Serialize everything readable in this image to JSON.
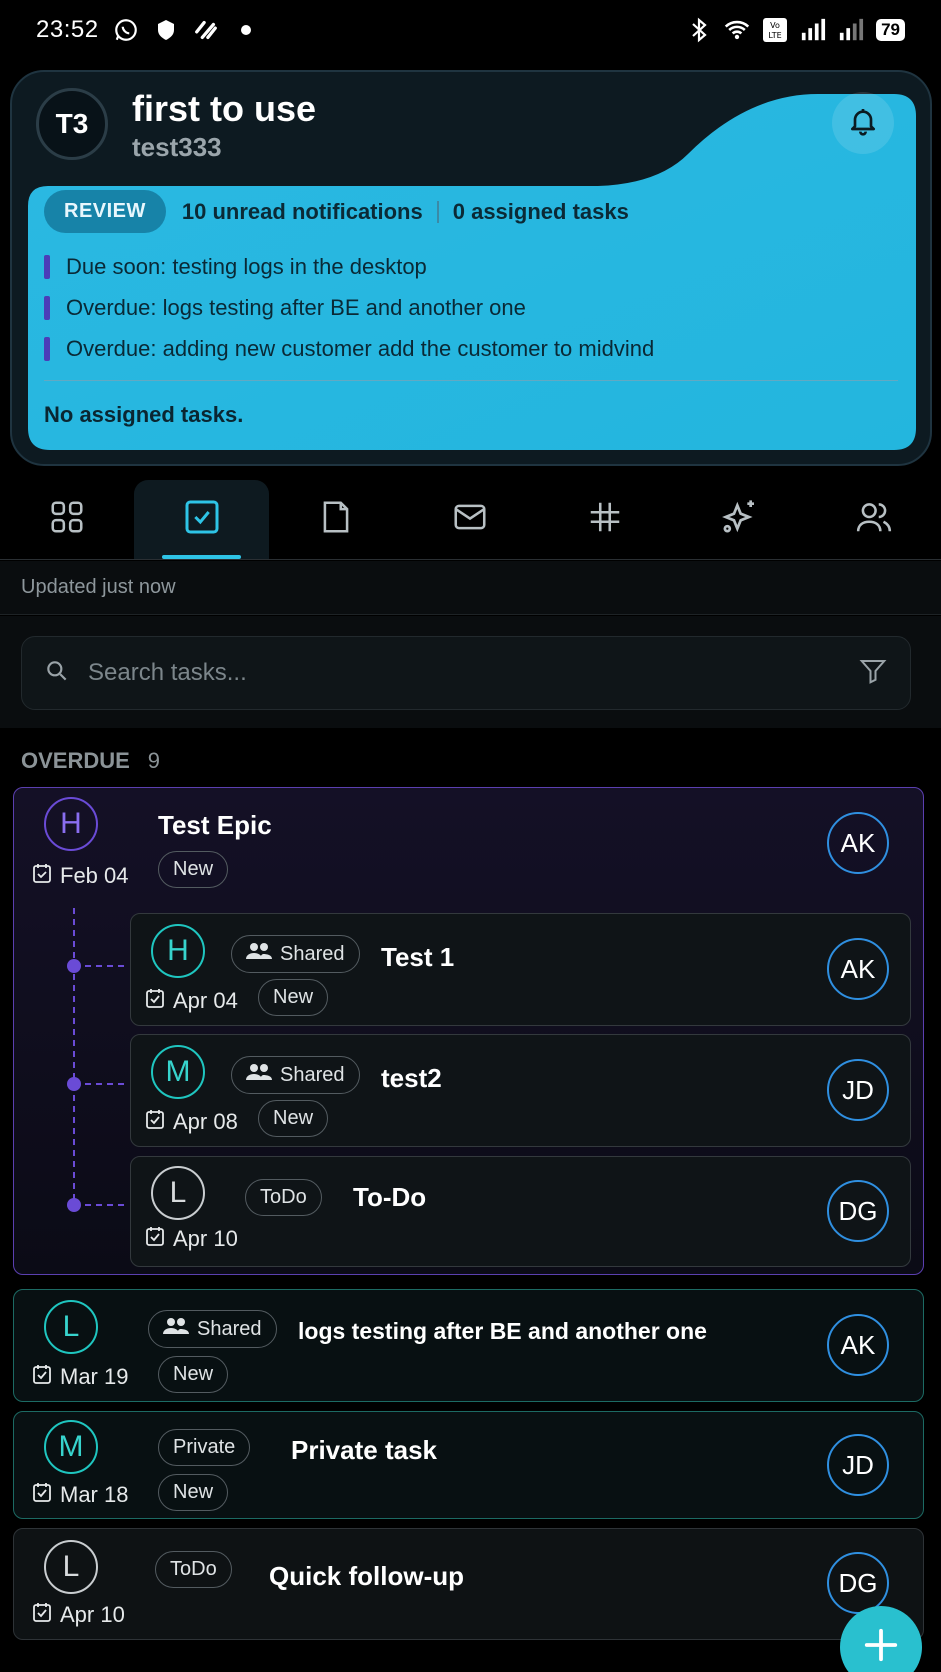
{
  "status_bar": {
    "time": "23:52",
    "battery": "79"
  },
  "header": {
    "avatar_initials": "T3",
    "title": "first to use",
    "subtitle": "test333",
    "review_label": "REVIEW",
    "unread": "10 unread notifications",
    "assigned": "0 assigned tasks",
    "notifications": [
      "Due soon: testing logs in the desktop",
      "Overdue: logs testing after BE and another one",
      "Overdue: adding new customer add the customer to midvind"
    ],
    "no_assigned": "No assigned tasks."
  },
  "tabs": [
    "dashboard",
    "tasks",
    "documents",
    "messages",
    "channels",
    "ai",
    "people"
  ],
  "active_tab": "tasks",
  "updated": "Updated just now",
  "search": {
    "placeholder": "Search tasks..."
  },
  "section": {
    "label": "OVERDUE",
    "count": "9"
  },
  "epic": {
    "letter": "H",
    "title": "Test Epic",
    "date": "Feb 04",
    "status": "New",
    "assignee": "AK",
    "children": [
      {
        "letter": "H",
        "scope": "Shared",
        "title": "Test 1",
        "date": "Apr 04",
        "status": "New",
        "assignee": "AK"
      },
      {
        "letter": "M",
        "scope": "Shared",
        "title": "test2",
        "date": "Apr 08",
        "status": "New",
        "assignee": "JD"
      },
      {
        "letter": "L",
        "scope": "ToDo",
        "title": "To-Do",
        "date": "Apr 10",
        "status": "",
        "assignee": "DG"
      }
    ]
  },
  "tasks": [
    {
      "letter": "L",
      "scope": "Shared",
      "title": "logs testing after BE and another one",
      "date": "Mar 19",
      "status": "New",
      "assignee": "AK"
    },
    {
      "letter": "M",
      "scope": "Private",
      "title": "Private task",
      "date": "Mar 18",
      "status": "New",
      "assignee": "JD"
    },
    {
      "letter": "L",
      "scope": "ToDo",
      "title": "Quick follow-up",
      "date": "Apr 10",
      "status": "",
      "assignee": "DG"
    }
  ],
  "colors": {
    "accent": "#2ec4e6",
    "epic_border": "#5b3fb0",
    "high": "#6a4bd6",
    "medium": "#1fc6c0",
    "low": "#c9cdd0",
    "assignee_ring": "#2f8fe0"
  }
}
